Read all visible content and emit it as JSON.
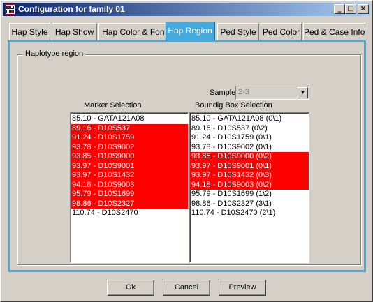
{
  "window": {
    "title": "Configuration for family 01"
  },
  "titlebar_buttons": {
    "minimize": "_",
    "maximize": "□",
    "close": "×"
  },
  "tabs": [
    {
      "label": "Hap Style",
      "active": false
    },
    {
      "label": "Hap Show",
      "active": false
    },
    {
      "label": "Hap Color & Font",
      "active": false
    },
    {
      "label": "Hap Region",
      "active": true
    },
    {
      "label": "Ped Style",
      "active": false
    },
    {
      "label": "Ped Color",
      "active": false
    },
    {
      "label": "Ped & Case Info",
      "active": false
    }
  ],
  "group": {
    "label": "Haplotype region"
  },
  "sample": {
    "label": "Sample",
    "value": "2-3"
  },
  "marker_selection": {
    "title": "Marker Selection",
    "items": [
      {
        "text": "85.10 - GATA121A08",
        "selected": false
      },
      {
        "text": "89.16 - D10S537",
        "selected": true
      },
      {
        "text": "91.24 - D10S1759",
        "selected": true
      },
      {
        "text": "93.78 - D10S9002",
        "selected": true
      },
      {
        "text": "93.85 - D10S9000",
        "selected": true
      },
      {
        "text": "93.97 - D10S9001",
        "selected": true
      },
      {
        "text": "93.97 - D10S1432",
        "selected": true
      },
      {
        "text": "94.18 - D10S9003",
        "selected": true
      },
      {
        "text": "95.79 - D10S1699",
        "selected": true
      },
      {
        "text": "98.86 - D10S2327",
        "selected": true
      },
      {
        "text": "110.74 - D10S2470",
        "selected": false
      }
    ]
  },
  "bounding_box_selection": {
    "title": "Boundig Box Selection",
    "items": [
      {
        "text": "85.10 - GATA121A08 (0\\1)",
        "selected": false
      },
      {
        "text": "89.16 - D10S537 (0\\2)",
        "selected": false
      },
      {
        "text": "91.24 - D10S1759 (0\\1)",
        "selected": false
      },
      {
        "text": "93.78 - D10S9002 (0\\1)",
        "selected": false
      },
      {
        "text": "93.85 - D10S9000 (0\\2)",
        "selected": true
      },
      {
        "text": "93.97 - D10S9001 (0\\1)",
        "selected": true
      },
      {
        "text": "93.97 - D10S1432 (0\\3)",
        "selected": true
      },
      {
        "text": "94.18 - D10S9003 (0\\2)",
        "selected": true
      },
      {
        "text": "95.79 - D10S1699 (1\\2)",
        "selected": false
      },
      {
        "text": "98.86 - D10S2327 (3\\1)",
        "selected": false
      },
      {
        "text": "110.74 - D10S2470 (2\\1)",
        "selected": false
      }
    ]
  },
  "buttons": {
    "ok": "Ok",
    "cancel": "Cancel",
    "preview": "Preview"
  },
  "colors": {
    "selection": "#ff0000",
    "active_tab": "#44aadd",
    "title_bar": "#0a246a"
  }
}
